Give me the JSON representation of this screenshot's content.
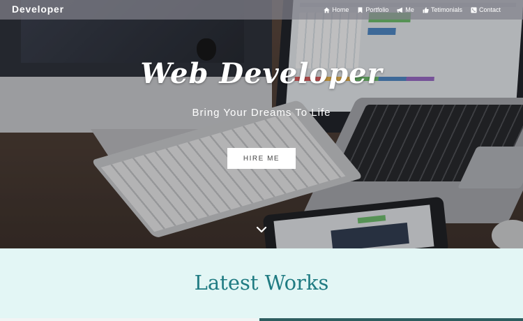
{
  "brand": "Developer",
  "nav": [
    {
      "label": "Home",
      "icon": "home-icon"
    },
    {
      "label": "Portfolio",
      "icon": "bookmark-icon"
    },
    {
      "label": "Me",
      "icon": "megaphone-icon"
    },
    {
      "label": "Tetimonials",
      "icon": "thumbs-up-icon"
    },
    {
      "label": "Contact",
      "icon": "phone-icon"
    }
  ],
  "hero": {
    "title": "Web Developer",
    "subtitle": "Bring Your Dreams To Life",
    "button": "HIRE ME",
    "scroll_icon": "chevron-down-icon"
  },
  "works": {
    "title": "Latest Works"
  },
  "colors": {
    "navbar": "#82828c",
    "works_background": "#e3f6f5",
    "works_title": "#1f7b82",
    "button_background": "#ffffff"
  }
}
